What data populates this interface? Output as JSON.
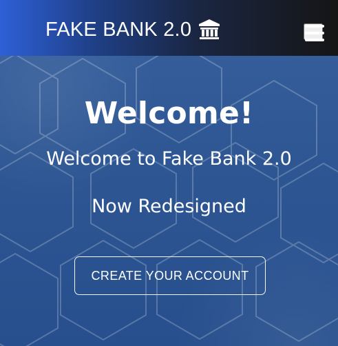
{
  "navbar": {
    "brand": "FAKE BANK 2.0",
    "brand_icon": "bank-icon",
    "menu_icon": "hamburger-menu-icon"
  },
  "hero": {
    "headline": "Welcome!",
    "subheadline": "Welcome to Fake Bank 2.0",
    "tagline": "Now Redesigned",
    "cta_label": "CREATE YOUR ACCOUNT"
  },
  "colors": {
    "navbar_gradient_start": "#2e60d6",
    "navbar_gradient_end": "#151515",
    "hero_background": "#2d5693",
    "text": "#ffffff"
  }
}
